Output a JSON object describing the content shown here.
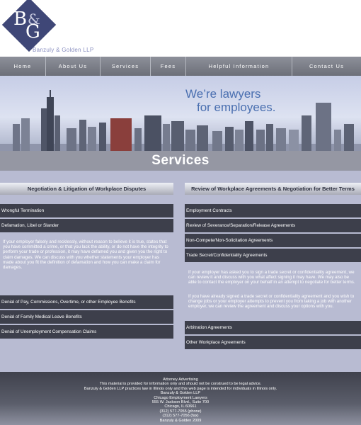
{
  "logo": {
    "mark_b": "B",
    "mark_amp": "&",
    "mark_g": "G",
    "firm_name": "Banzuly & Golden LLP"
  },
  "nav": [
    {
      "label": "Home"
    },
    {
      "label": "About Us"
    },
    {
      "label": "Services"
    },
    {
      "label": "Fees"
    },
    {
      "label": "Helpful Information"
    },
    {
      "label": "Contact Us"
    }
  ],
  "hero": {
    "tagline_line1": "We’re lawyers",
    "tagline_line2": "for employees."
  },
  "page_title": "Services",
  "left_column": {
    "heading": "Negotiation & Litigation of Workplace Disputes",
    "items": [
      {
        "label": "Wrongful Termination"
      },
      {
        "label": "Defamation, Libel or Slander"
      },
      {
        "label": "Denial of Pay, Commissions, Overtime, or other Employee Benefits"
      },
      {
        "label": "Denial of Family Medical Leave Benefits"
      },
      {
        "label": "Denial of Unemployment Compensation Claims"
      }
    ],
    "paragraph": "If your employer falsely and recklessly, without reason to believe it is true, states that you have committed a crime, or that you lack the ability, or do not have the integrity to perform your trade or profession, it may have defamed you and given you the right to claim damages.  We can discuss with you whether statements your employer has made about you fit the definition of defamation and how you can make a claim for damages."
  },
  "right_column": {
    "heading": "Review of Workplace Agreements & Negotiation for Better Terms",
    "items": [
      {
        "label": "Employment Contracts"
      },
      {
        "label": "Review of Severance/Separation/Release Agreements"
      },
      {
        "label": "Non-Compete/Non-Solicitation Agreements"
      },
      {
        "label": "Trade Secret/Confidentiality Agreements"
      },
      {
        "label": "Arbitration Agreements"
      },
      {
        "label": "Other Workplace Agreements"
      }
    ],
    "paragraph1": "If your employer has asked you to sign a trade secret or confidentiality agreement, we can review it and discuss with you what affect signing it may have. We may also be able to contact the employer on your behalf in an attempt to negotiate for better terms.",
    "paragraph2": "If you have already signed a trade secret or confidentiality agreement and you wish to change jobs or your employer attempts to prevent you from taking a job with another employer, we can review the agreement and discuss your options with you."
  },
  "footer": {
    "lines": [
      "Attorney Advertising",
      "This material is provided for information only and should not be construed to be legal advice.",
      "Banzuly & Golden LLP practices law in Illinois only and this web page is intended for individuals in Illinois only.",
      "Banzuly & Golden LLP",
      "Chicago Employment Lawyers",
      "555 W. Jackson Blvd., Suite 700",
      "Chicago, IL 60661",
      "(312) 577-7055 (phone)",
      "(312) 577-7056 (fax)",
      "Banzuly & Golden 2009"
    ]
  },
  "colors": {
    "brand_navy": "#3f4777",
    "tagline_blue": "#4a6fb0",
    "item_bar": "#3d3f4b",
    "content_bg": "#b8bbd2"
  }
}
